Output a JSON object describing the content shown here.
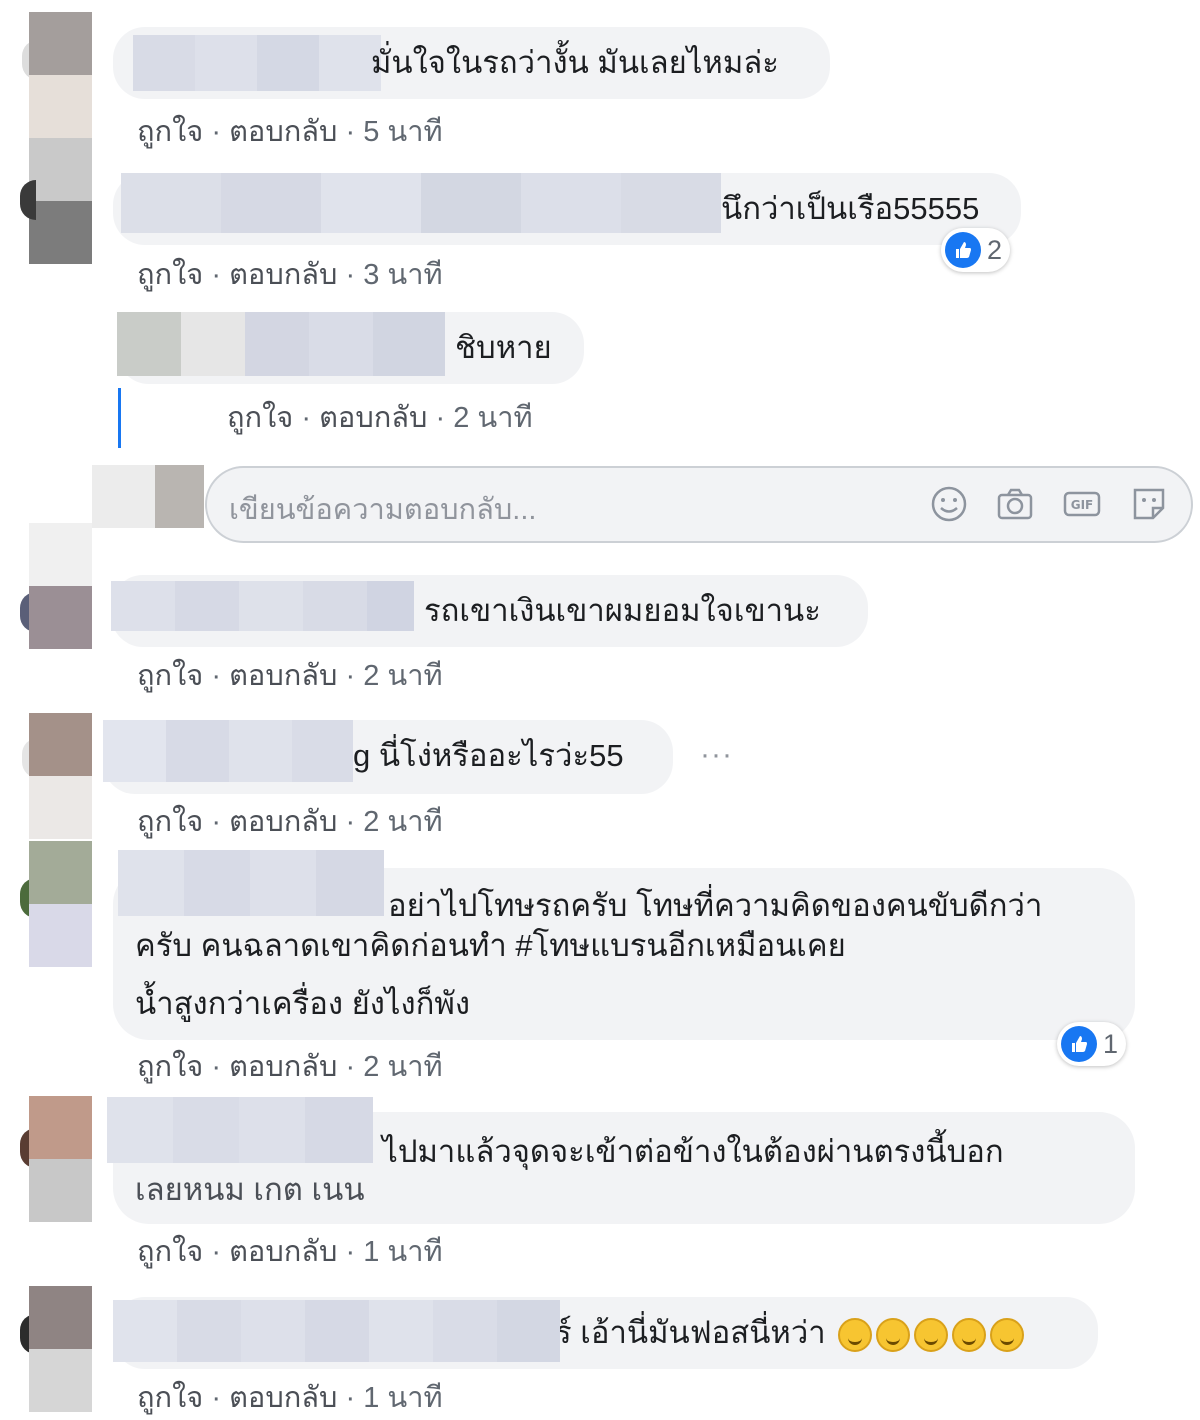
{
  "meta": {
    "like": "ถูกใจ",
    "reply": "ตอบกลับ",
    "separator": " · "
  },
  "comments": [
    {
      "text": "มั่นใจในรถว่างั้น มันเลยไหมล่ะ",
      "time": "5 นาที"
    },
    {
      "text": "นึกว่าเป็นเรือ55555",
      "time": "3 นาที",
      "reaction_count": "2"
    },
    {
      "text": "ชิบหาย",
      "time": "2 นาที"
    },
    {
      "text": "รถเขาเงินเขาผมยอมใจเขานะ",
      "time": "2 นาที"
    },
    {
      "text": "g นี่โง่หรืออะไรว่ะ55",
      "time": "2 นาที",
      "more": "···"
    },
    {
      "line1": "อย่าไปโทษรถครับ โทษที่ความคิดของคนขับดีกว่า",
      "line2": "ครับ คนฉลาดเขาคิดก่อนทำ #โทษแบรนอีกเหมือนเคย",
      "line3": "น้ำสูงกว่าเครื่อง ยังไงก็พัง",
      "time": "2 นาที",
      "reaction_count": "1"
    },
    {
      "line1": ": ไปมาแล้วจุดจะเข้าต่อข้างในต้องผ่านตรงนี้บอก",
      "line2": "เลยหนม เกต เนน",
      "time": "1 นาที"
    },
    {
      "text": "ร์ เอ้านี่มันฟอสนี่หว่า",
      "time": "1 นาที"
    }
  ],
  "reply_box": {
    "placeholder": "เขียนข้อความตอบกลับ..."
  },
  "icons": [
    "emoji-icon",
    "camera-icon",
    "gif-icon",
    "sticker-icon",
    "like-icon",
    "more-icon"
  ],
  "colors": {
    "like_blue": "#1877f2",
    "bubble": "#f2f3f5",
    "meta_text": "#606770"
  }
}
